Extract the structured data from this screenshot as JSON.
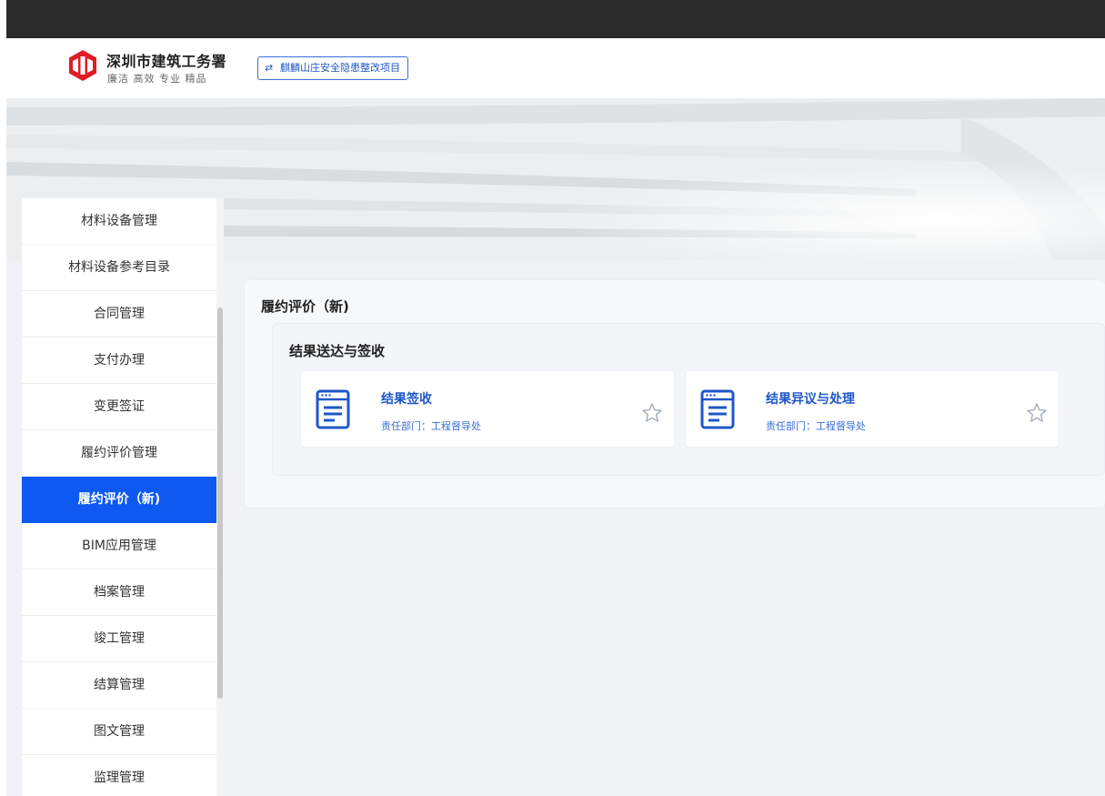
{
  "header": {
    "brand_name": "深圳市建筑工务署",
    "brand_slogan": "廉洁 高效 专业 精品",
    "project_button": "麒麟山庄安全隐患整改项目",
    "logo_icon": "brand-logo-icon",
    "swap_icon": "swap-icon"
  },
  "sidebar": {
    "items": [
      {
        "label": "材料设备管理",
        "active": false
      },
      {
        "label": "材料设备参考目录",
        "active": false
      },
      {
        "label": "合同管理",
        "active": false
      },
      {
        "label": "支付办理",
        "active": false
      },
      {
        "label": "变更签证",
        "active": false
      },
      {
        "label": "履约评价管理",
        "active": false
      },
      {
        "label": "履约评价（新)",
        "active": true
      },
      {
        "label": "BIM应用管理",
        "active": false
      },
      {
        "label": "档案管理",
        "active": false
      },
      {
        "label": "竣工管理",
        "active": false
      },
      {
        "label": "结算管理",
        "active": false
      },
      {
        "label": "图文管理",
        "active": false
      },
      {
        "label": "监理管理",
        "active": false
      }
    ]
  },
  "main": {
    "title": "履约评价（新)",
    "group": {
      "title": "结果送达与签收",
      "cards": [
        {
          "title": "结果签收",
          "dept": "责任部门：工程督导处",
          "icon": "document-icon",
          "favorite_icon": "star-icon"
        },
        {
          "title": "结果异议与处理",
          "dept": "责任部门：工程督导处",
          "icon": "document-icon",
          "favorite_icon": "star-icon"
        }
      ]
    }
  },
  "colors": {
    "accent": "#0d59f2",
    "brand_red": "#e01c24",
    "link_blue": "#1f57c8",
    "content_bg": "#f0f2f5",
    "top_bar": "#2b2b2b"
  }
}
